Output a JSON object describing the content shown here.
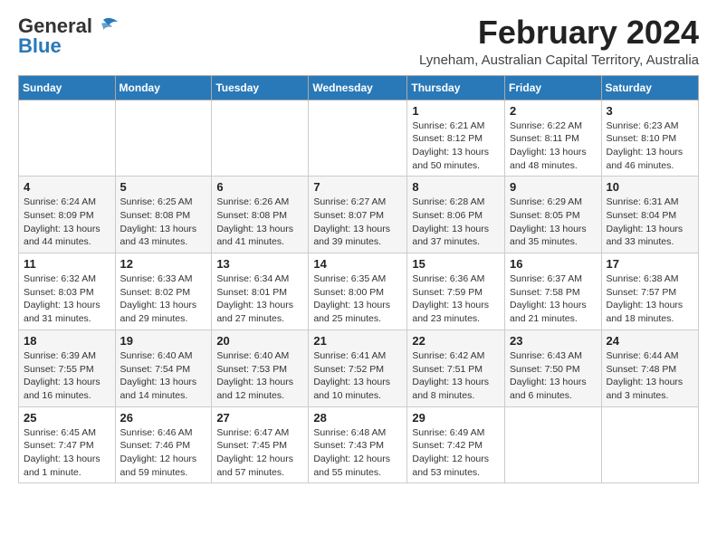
{
  "header": {
    "logo_general": "General",
    "logo_blue": "Blue",
    "month_title": "February 2024",
    "subtitle": "Lyneham, Australian Capital Territory, Australia"
  },
  "days_of_week": [
    "Sunday",
    "Monday",
    "Tuesday",
    "Wednesday",
    "Thursday",
    "Friday",
    "Saturday"
  ],
  "weeks": [
    [
      {
        "day": "",
        "info": ""
      },
      {
        "day": "",
        "info": ""
      },
      {
        "day": "",
        "info": ""
      },
      {
        "day": "",
        "info": ""
      },
      {
        "day": "1",
        "info": "Sunrise: 6:21 AM\nSunset: 8:12 PM\nDaylight: 13 hours\nand 50 minutes."
      },
      {
        "day": "2",
        "info": "Sunrise: 6:22 AM\nSunset: 8:11 PM\nDaylight: 13 hours\nand 48 minutes."
      },
      {
        "day": "3",
        "info": "Sunrise: 6:23 AM\nSunset: 8:10 PM\nDaylight: 13 hours\nand 46 minutes."
      }
    ],
    [
      {
        "day": "4",
        "info": "Sunrise: 6:24 AM\nSunset: 8:09 PM\nDaylight: 13 hours\nand 44 minutes."
      },
      {
        "day": "5",
        "info": "Sunrise: 6:25 AM\nSunset: 8:08 PM\nDaylight: 13 hours\nand 43 minutes."
      },
      {
        "day": "6",
        "info": "Sunrise: 6:26 AM\nSunset: 8:08 PM\nDaylight: 13 hours\nand 41 minutes."
      },
      {
        "day": "7",
        "info": "Sunrise: 6:27 AM\nSunset: 8:07 PM\nDaylight: 13 hours\nand 39 minutes."
      },
      {
        "day": "8",
        "info": "Sunrise: 6:28 AM\nSunset: 8:06 PM\nDaylight: 13 hours\nand 37 minutes."
      },
      {
        "day": "9",
        "info": "Sunrise: 6:29 AM\nSunset: 8:05 PM\nDaylight: 13 hours\nand 35 minutes."
      },
      {
        "day": "10",
        "info": "Sunrise: 6:31 AM\nSunset: 8:04 PM\nDaylight: 13 hours\nand 33 minutes."
      }
    ],
    [
      {
        "day": "11",
        "info": "Sunrise: 6:32 AM\nSunset: 8:03 PM\nDaylight: 13 hours\nand 31 minutes."
      },
      {
        "day": "12",
        "info": "Sunrise: 6:33 AM\nSunset: 8:02 PM\nDaylight: 13 hours\nand 29 minutes."
      },
      {
        "day": "13",
        "info": "Sunrise: 6:34 AM\nSunset: 8:01 PM\nDaylight: 13 hours\nand 27 minutes."
      },
      {
        "day": "14",
        "info": "Sunrise: 6:35 AM\nSunset: 8:00 PM\nDaylight: 13 hours\nand 25 minutes."
      },
      {
        "day": "15",
        "info": "Sunrise: 6:36 AM\nSunset: 7:59 PM\nDaylight: 13 hours\nand 23 minutes."
      },
      {
        "day": "16",
        "info": "Sunrise: 6:37 AM\nSunset: 7:58 PM\nDaylight: 13 hours\nand 21 minutes."
      },
      {
        "day": "17",
        "info": "Sunrise: 6:38 AM\nSunset: 7:57 PM\nDaylight: 13 hours\nand 18 minutes."
      }
    ],
    [
      {
        "day": "18",
        "info": "Sunrise: 6:39 AM\nSunset: 7:55 PM\nDaylight: 13 hours\nand 16 minutes."
      },
      {
        "day": "19",
        "info": "Sunrise: 6:40 AM\nSunset: 7:54 PM\nDaylight: 13 hours\nand 14 minutes."
      },
      {
        "day": "20",
        "info": "Sunrise: 6:40 AM\nSunset: 7:53 PM\nDaylight: 13 hours\nand 12 minutes."
      },
      {
        "day": "21",
        "info": "Sunrise: 6:41 AM\nSunset: 7:52 PM\nDaylight: 13 hours\nand 10 minutes."
      },
      {
        "day": "22",
        "info": "Sunrise: 6:42 AM\nSunset: 7:51 PM\nDaylight: 13 hours\nand 8 minutes."
      },
      {
        "day": "23",
        "info": "Sunrise: 6:43 AM\nSunset: 7:50 PM\nDaylight: 13 hours\nand 6 minutes."
      },
      {
        "day": "24",
        "info": "Sunrise: 6:44 AM\nSunset: 7:48 PM\nDaylight: 13 hours\nand 3 minutes."
      }
    ],
    [
      {
        "day": "25",
        "info": "Sunrise: 6:45 AM\nSunset: 7:47 PM\nDaylight: 13 hours\nand 1 minute."
      },
      {
        "day": "26",
        "info": "Sunrise: 6:46 AM\nSunset: 7:46 PM\nDaylight: 12 hours\nand 59 minutes."
      },
      {
        "day": "27",
        "info": "Sunrise: 6:47 AM\nSunset: 7:45 PM\nDaylight: 12 hours\nand 57 minutes."
      },
      {
        "day": "28",
        "info": "Sunrise: 6:48 AM\nSunset: 7:43 PM\nDaylight: 12 hours\nand 55 minutes."
      },
      {
        "day": "29",
        "info": "Sunrise: 6:49 AM\nSunset: 7:42 PM\nDaylight: 12 hours\nand 53 minutes."
      },
      {
        "day": "",
        "info": ""
      },
      {
        "day": "",
        "info": ""
      }
    ]
  ]
}
